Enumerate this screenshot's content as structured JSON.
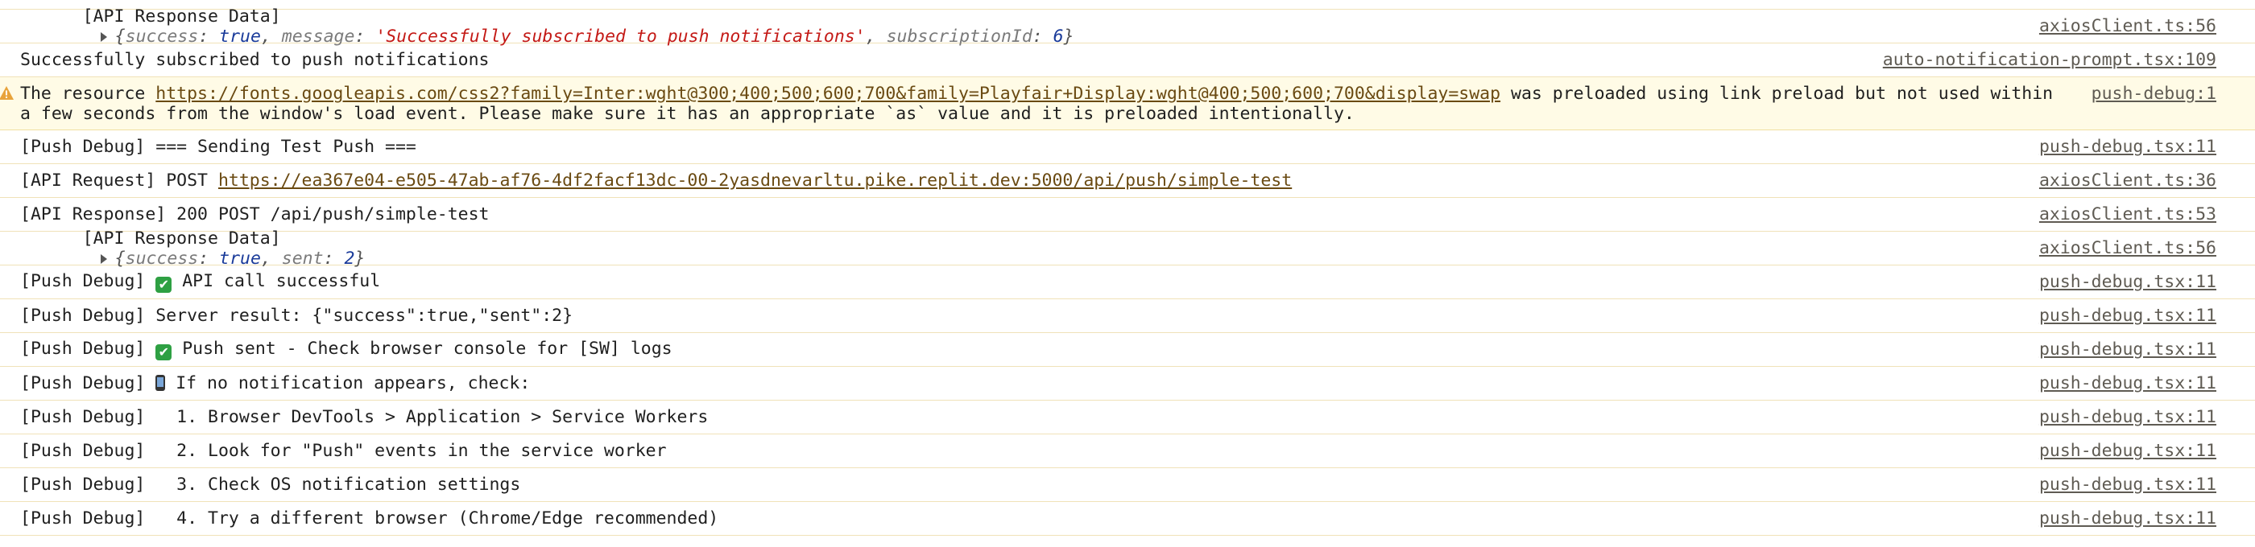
{
  "rows": [
    {
      "id": "api-response-data-1",
      "prefix": "[API Response Data]",
      "obj": {
        "open": "{",
        "k1": "success",
        "v1": "true",
        "k2": "message",
        "v2": "'Successfully subscribed to push notifications'",
        "k3": "subscriptionId",
        "v3": "6",
        "close": "}"
      },
      "source": "axiosClient.ts:56"
    },
    {
      "id": "subscribed-log",
      "text": "Successfully subscribed to push notifications",
      "source": "auto-notification-prompt.tsx:109"
    },
    {
      "id": "preload-warning",
      "pre": "The resource ",
      "link": "https://fonts.googleapis.com/css2?family=Inter:wght@300;400;500;600;700&family=Playfair+Display:wght@400;500;600;700&display=swap",
      "post": " was preloaded using link preload but not used within a few seconds from the window's load event. Please make sure it has an appropriate `as` value and it is preloaded intentionally.",
      "source": "push-debug:1"
    },
    {
      "id": "sending-test-push",
      "text": "[Push Debug] === Sending Test Push ===",
      "source": "push-debug.tsx:11"
    },
    {
      "id": "api-request",
      "pre": "[API Request] POST ",
      "link": "https://ea367e04-e505-47ab-af76-4df2facf13dc-00-2yasdnevarltu.pike.replit.dev:5000/api/push/simple-test",
      "source": "axiosClient.ts:36"
    },
    {
      "id": "api-response",
      "text": "[API Response] 200 POST /api/push/simple-test",
      "source": "axiosClient.ts:53"
    },
    {
      "id": "api-response-data-2",
      "prefix": "[API Response Data]",
      "obj": {
        "open": "{",
        "k1": "success",
        "v1": "true",
        "k2": "sent",
        "v2": "2",
        "close": "}"
      },
      "source": "axiosClient.ts:56"
    },
    {
      "id": "api-call-successful",
      "pre": "[Push Debug] ",
      "post": " API call successful",
      "source": "push-debug.tsx:11"
    },
    {
      "id": "server-result",
      "text": "[Push Debug] Server result: {\"success\":true,\"sent\":2}",
      "source": "push-debug.tsx:11"
    },
    {
      "id": "push-sent",
      "pre": "[Push Debug] ",
      "post": " Push sent - Check browser console for [SW] logs",
      "source": "push-debug.tsx:11"
    },
    {
      "id": "if-no-notification",
      "pre": "[Push Debug] ",
      "post": " If no notification appears, check:",
      "source": "push-debug.tsx:11"
    },
    {
      "id": "step-1",
      "text": "[Push Debug]   1. Browser DevTools > Application > Service Workers",
      "source": "push-debug.tsx:11"
    },
    {
      "id": "step-2",
      "text": "[Push Debug]   2. Look for \"Push\" events in the service worker",
      "source": "push-debug.tsx:11"
    },
    {
      "id": "step-3",
      "text": "[Push Debug]   3. Check OS notification settings",
      "source": "push-debug.tsx:11"
    },
    {
      "id": "step-4",
      "text": "[Push Debug]   4. Try a different browser (Chrome/Edge recommended)",
      "source": "push-debug.tsx:11"
    }
  ]
}
